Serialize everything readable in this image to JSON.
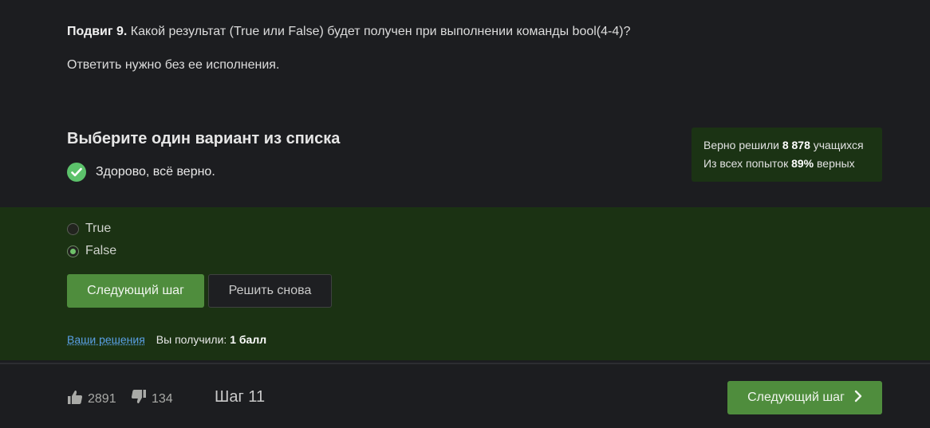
{
  "question": {
    "label": "Подвиг 9.",
    "text": " Какой результат (True или False) будет получен при выполнении команды bool(4-4)?",
    "note": "Ответить нужно без ее исполнения."
  },
  "section_title": "Выберите один вариант из списка",
  "result_message": "Здорово, всё верно.",
  "stats": {
    "line1_prefix": "Верно решили ",
    "solved_count": "8 878",
    "line1_suffix": " учащихся",
    "line2_prefix": "Из всех попыток ",
    "correct_percent": "89%",
    "line2_suffix": " верных"
  },
  "options": [
    {
      "label": "True",
      "selected": false
    },
    {
      "label": "False",
      "selected": true
    }
  ],
  "buttons": {
    "next_step": "Следующий шаг",
    "retry": "Решить снова"
  },
  "solutions": {
    "link": "Ваши решения",
    "score_prefix": "Вы получили: ",
    "score_value": "1 балл"
  },
  "footer": {
    "likes": "2891",
    "dislikes": "134",
    "step": "Шаг 11",
    "next_button": "Следующий шаг"
  },
  "colors": {
    "accent_green": "#4f8d3d",
    "success_check": "#5cc26b",
    "link_blue": "#5aa0e6"
  },
  "icons": [
    "check-circle-icon",
    "radio-icon",
    "thumbs-up-icon",
    "thumbs-down-icon",
    "chevron-right-icon"
  ]
}
